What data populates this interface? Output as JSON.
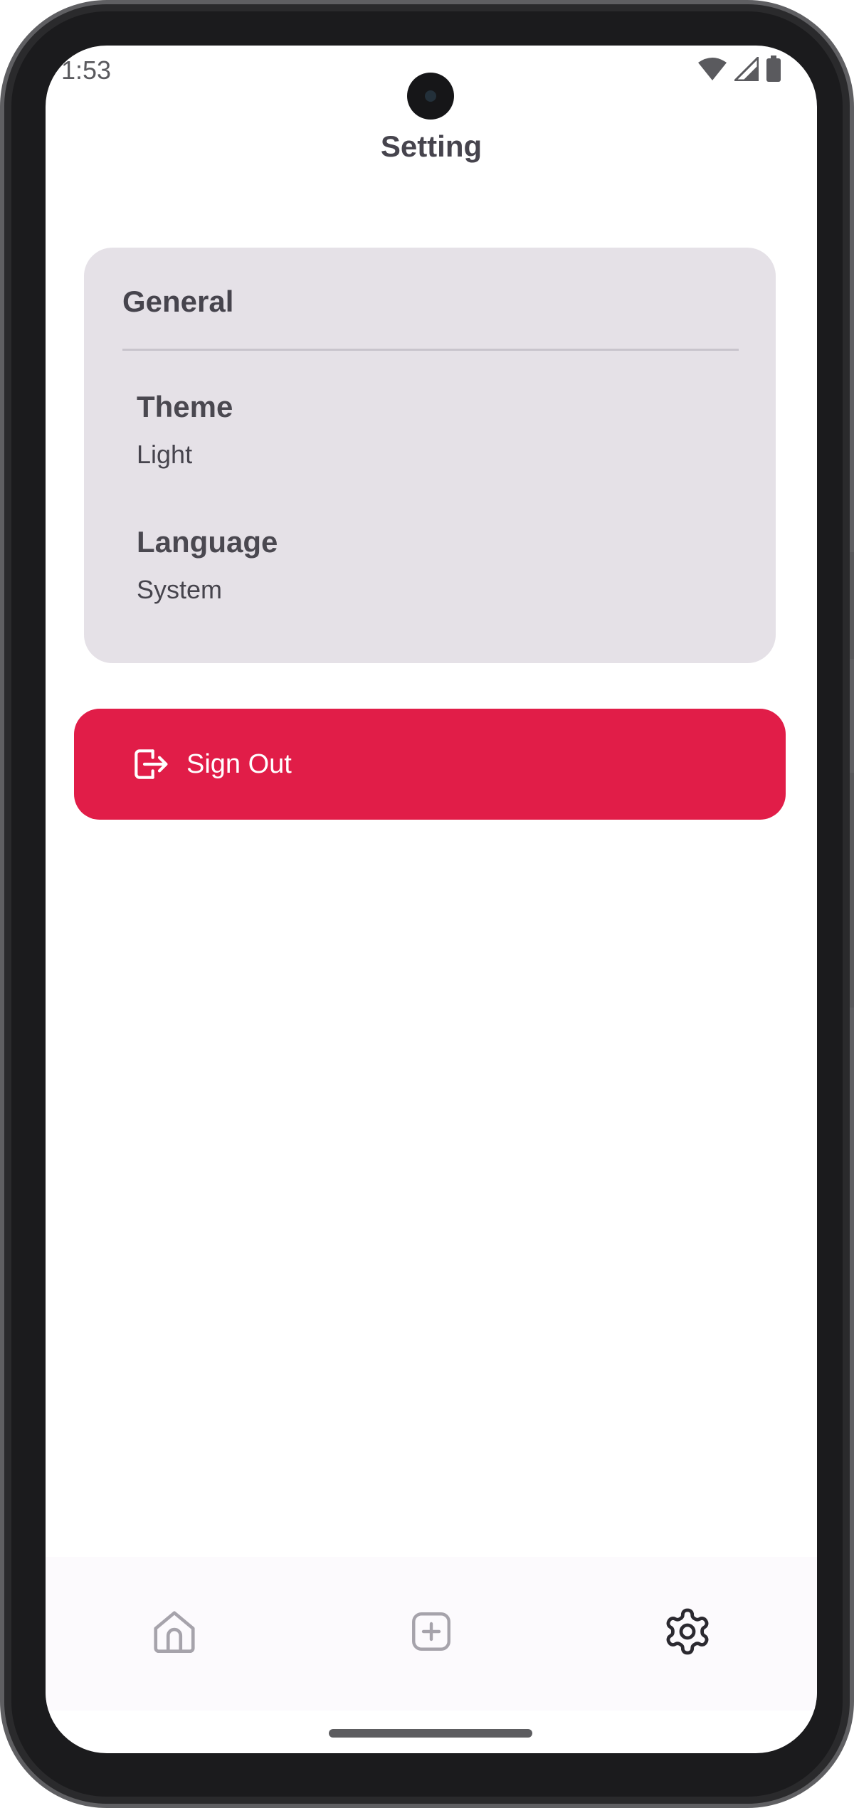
{
  "status_bar": {
    "time": "1:53",
    "icons": [
      "wifi-icon",
      "signal-icon",
      "battery-icon"
    ]
  },
  "header": {
    "title": "Setting"
  },
  "general_section": {
    "title": "General",
    "items": [
      {
        "label": "Theme",
        "value": "Light"
      },
      {
        "label": "Language",
        "value": "System"
      }
    ]
  },
  "sign_out": {
    "label": "Sign Out",
    "icon": "logout-icon"
  },
  "bottom_nav": {
    "items": [
      {
        "name": "home",
        "icon": "home-icon",
        "active": false
      },
      {
        "name": "add",
        "icon": "add-square-icon",
        "active": false
      },
      {
        "name": "settings",
        "icon": "gear-icon",
        "active": true
      }
    ]
  },
  "colors": {
    "accent": "#e11d48",
    "card_background": "#e5e1e7",
    "text_primary": "#46444d",
    "nav_inactive": "#a6a3ab",
    "nav_active": "#2b2930"
  }
}
